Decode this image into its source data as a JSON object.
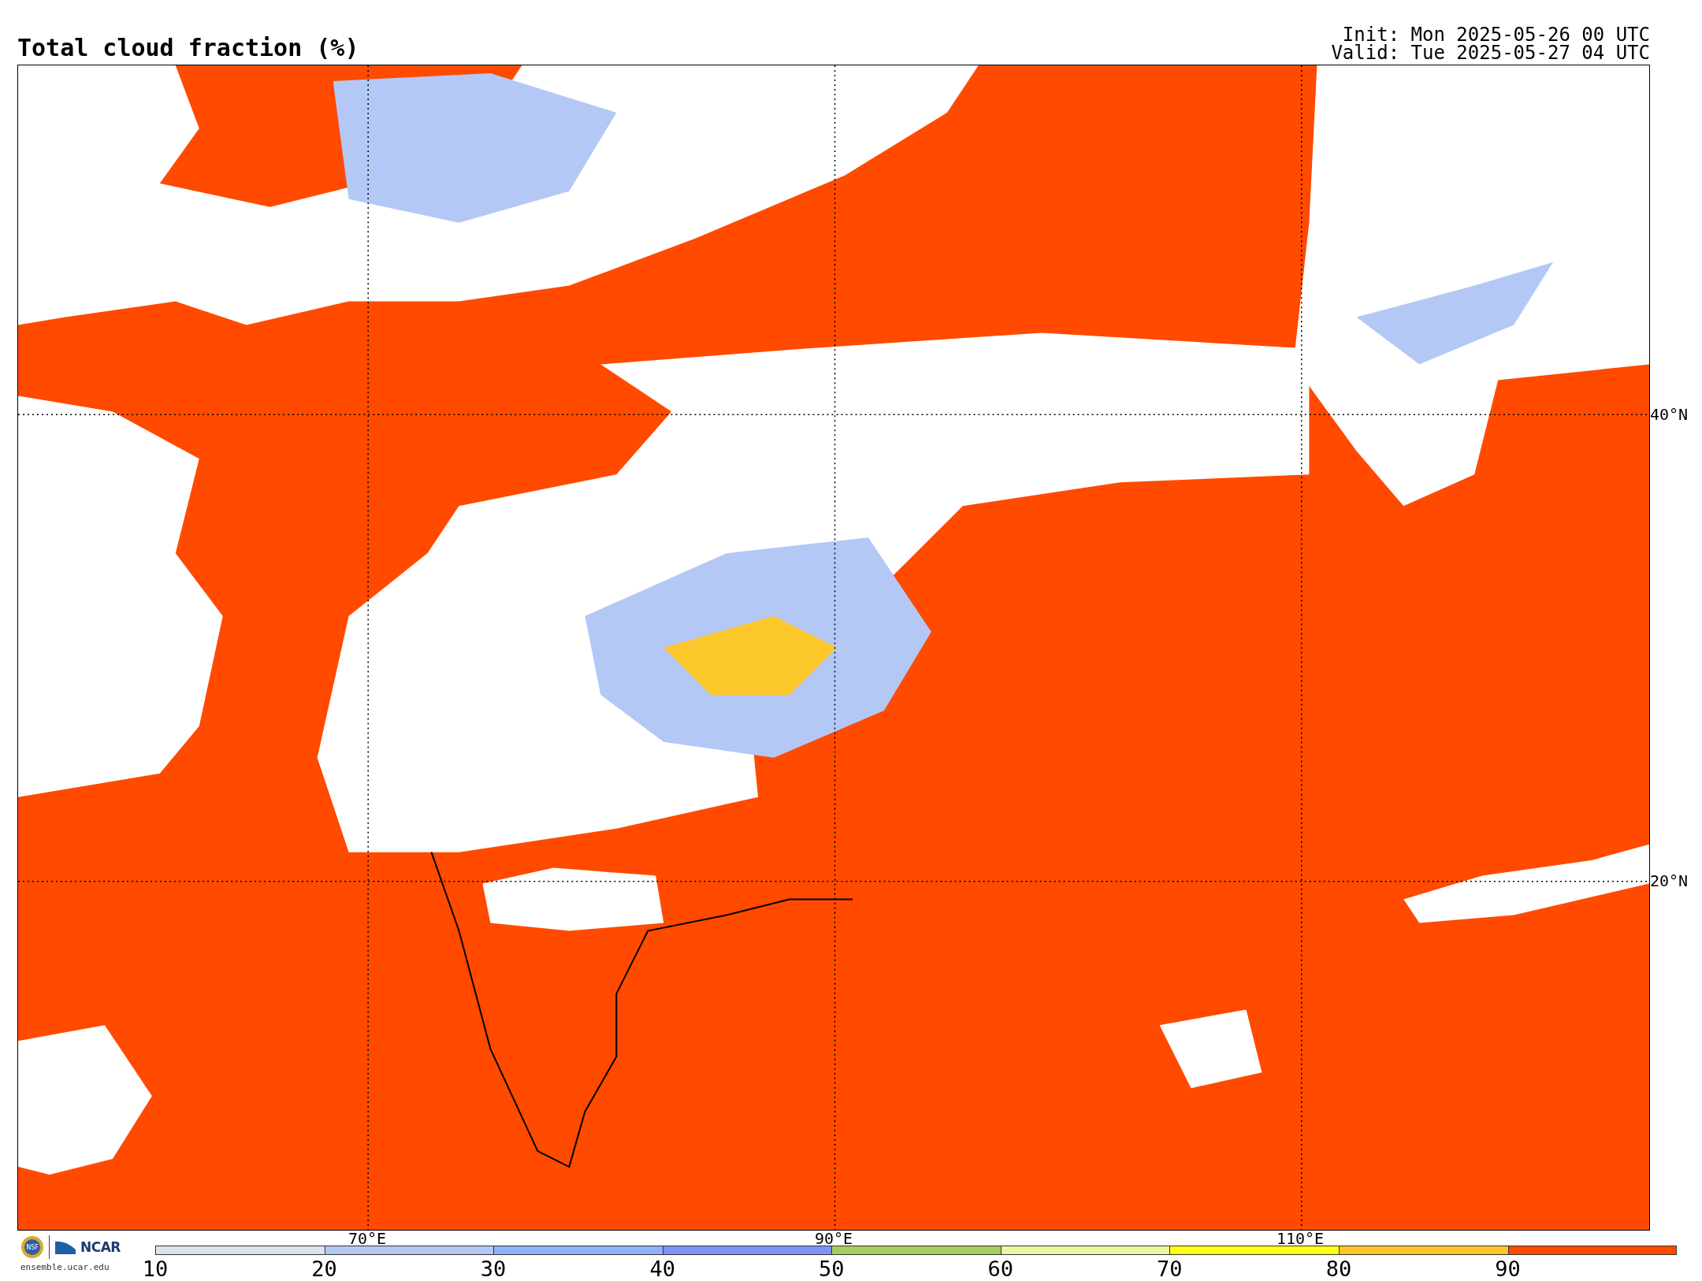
{
  "title": "Total cloud fraction (%)",
  "init": "Init: Mon 2025-05-26 00 UTC",
  "valid": "Valid: Tue 2025-05-27 04 UTC",
  "lat_labels": [
    "40°N",
    "20°N"
  ],
  "lon_labels": [
    "70°E",
    "90°E",
    "110°E"
  ],
  "logo": {
    "seal": "NSF",
    "org": "NCAR",
    "url": "ensemble.ucar.edu"
  },
  "colorbar": [
    {
      "label": "10",
      "color": "#d9e4ec"
    },
    {
      "label": "20",
      "color": "#b4c8f6"
    },
    {
      "label": "30",
      "color": "#8fb0f8"
    },
    {
      "label": "40",
      "color": "#7f93f5"
    },
    {
      "label": "50",
      "color": "#a6cc62"
    },
    {
      "label": "60",
      "color": "#ecf5a4"
    },
    {
      "label": "70",
      "color": "#ffff1a"
    },
    {
      "label": "80",
      "color": "#fcc72a"
    },
    {
      "label": "90",
      "color": "#ff4a00"
    }
  ]
}
